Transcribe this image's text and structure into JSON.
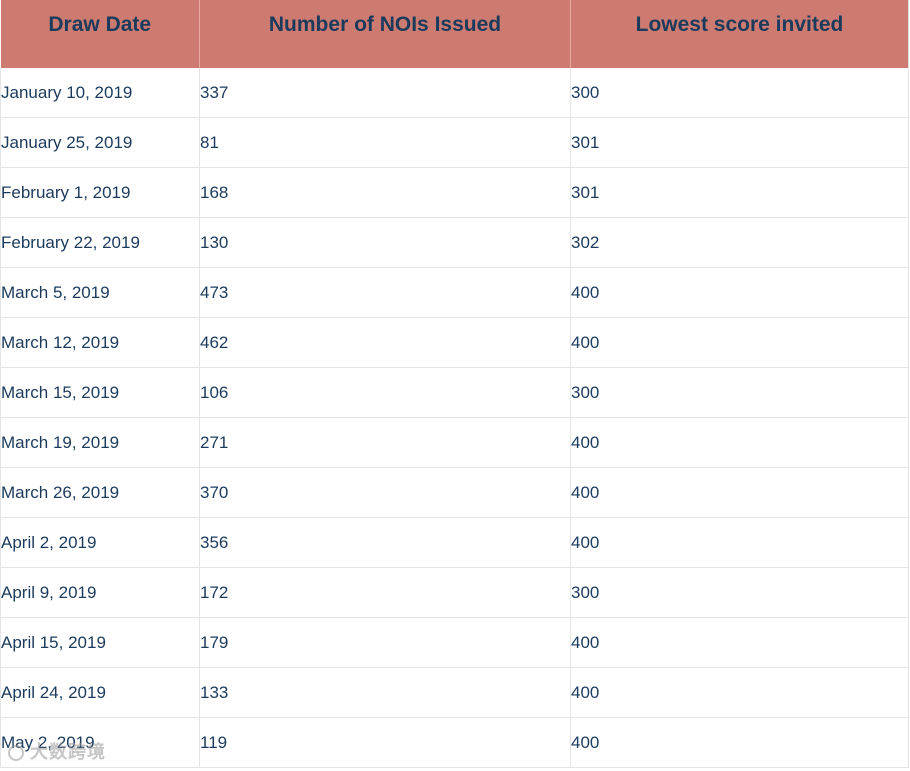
{
  "table": {
    "headers": [
      "Draw Date",
      "Number of NOIs Issued",
      "Lowest score invited"
    ],
    "rows": [
      [
        "January 10, 2019",
        "337",
        "300"
      ],
      [
        "January 25, 2019",
        "81",
        "301"
      ],
      [
        "February 1, 2019",
        "168",
        "301"
      ],
      [
        "February 22, 2019",
        "130",
        "302"
      ],
      [
        "March 5, 2019",
        "473",
        "400"
      ],
      [
        "March 12, 2019",
        "462",
        "400"
      ],
      [
        "March 15, 2019",
        "106",
        "300"
      ],
      [
        "March 19, 2019",
        "271",
        "400"
      ],
      [
        "March 26, 2019",
        "370",
        "400"
      ],
      [
        "April 2, 2019",
        "356",
        "400"
      ],
      [
        "April 9, 2019",
        "172",
        "300"
      ],
      [
        "April 15, 2019",
        "179",
        "400"
      ],
      [
        "April 24, 2019",
        "133",
        "400"
      ],
      [
        "May 2, 2019",
        "119",
        "400"
      ]
    ]
  },
  "watermark": {
    "text": "大数跨境",
    "icon": "logo-circle-icon"
  },
  "colors": {
    "header_bg": "#cd7b70",
    "header_text": "#1b3a5c",
    "body_text": "#1b3a5c",
    "grid": "#e4e4e4"
  }
}
